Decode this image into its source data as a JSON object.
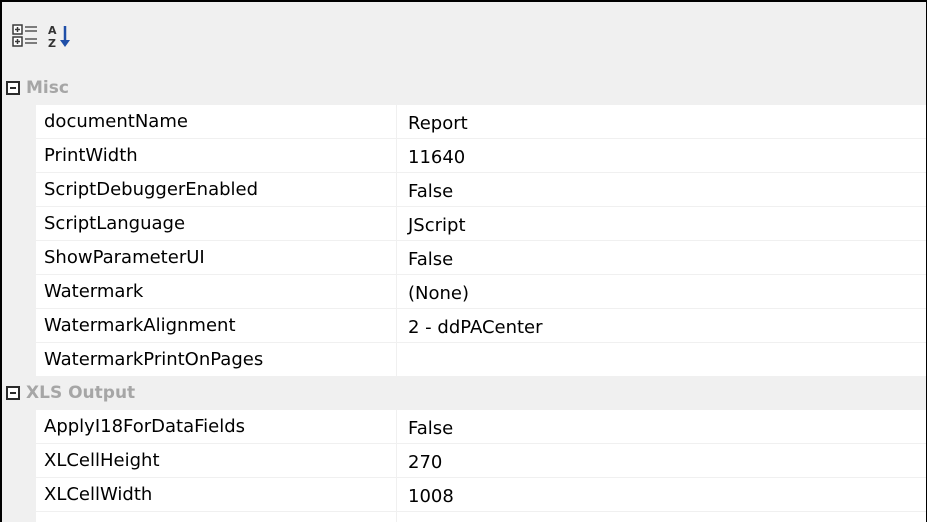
{
  "toolbar": {
    "categorized_icon": "categorized-view-icon",
    "alphabetical_icon": "alphabetical-sort-icon"
  },
  "categories": [
    {
      "label": "Misc",
      "expanded": true,
      "properties": [
        {
          "name": "documentName",
          "value": "Report"
        },
        {
          "name": "PrintWidth",
          "value": "11640"
        },
        {
          "name": "ScriptDebuggerEnabled",
          "value": "False"
        },
        {
          "name": "ScriptLanguage",
          "value": "JScript"
        },
        {
          "name": "ShowParameterUI",
          "value": "False"
        },
        {
          "name": "Watermark",
          "value": "(None)"
        },
        {
          "name": "WatermarkAlignment",
          "value": "2 - ddPACenter"
        },
        {
          "name": "WatermarkPrintOnPages",
          "value": ""
        }
      ]
    },
    {
      "label": "XLS Output",
      "expanded": true,
      "properties": [
        {
          "name": "ApplyI18ForDataFields",
          "value": "False"
        },
        {
          "name": "XLCellHeight",
          "value": "270"
        },
        {
          "name": "XLCellWidth",
          "value": "1008"
        }
      ]
    }
  ],
  "colors": {
    "toolbar_bg": "#f0f0f0",
    "category_text": "#a6a6a6",
    "text": "#000000"
  }
}
